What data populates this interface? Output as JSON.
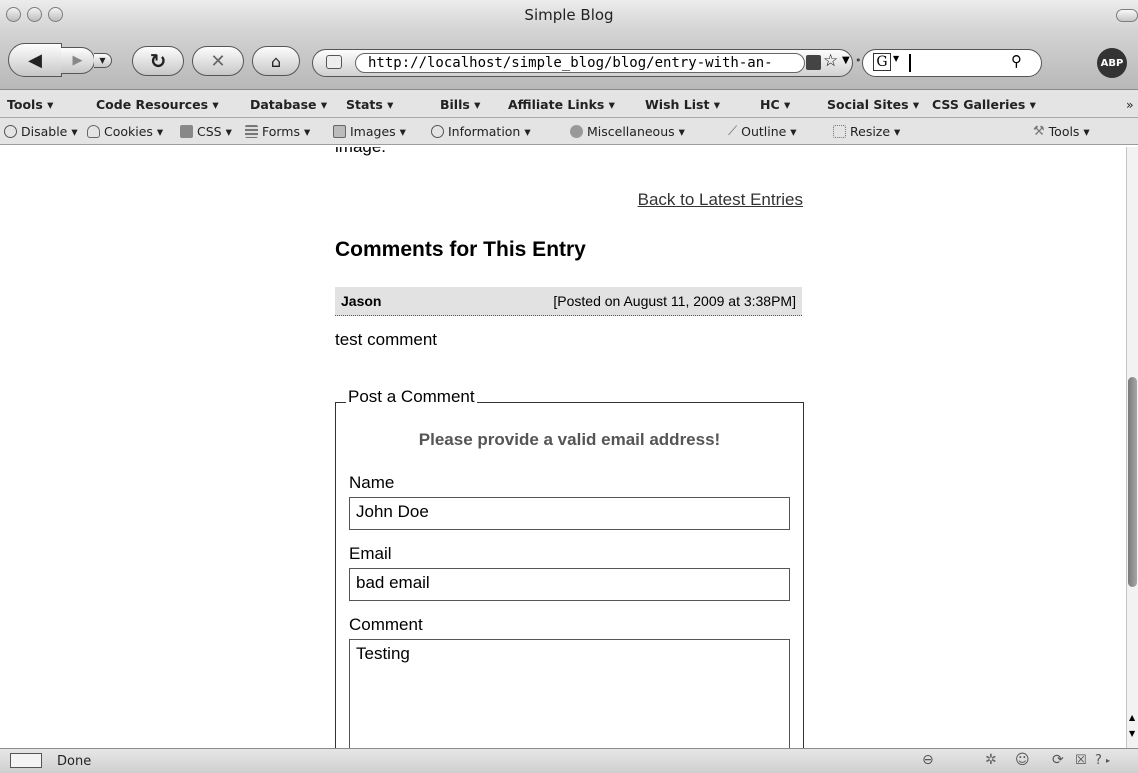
{
  "window": {
    "title": "Simple Blog"
  },
  "nav": {
    "url": "http://localhost/simple_blog/blog/entry-with-an-",
    "search_engine_letter": "G",
    "adblock_label": "ABP"
  },
  "bookmarks": [
    "Tools ▾",
    "Code Resources ▾",
    "Database ▾",
    "Stats ▾",
    "Bills ▾",
    "Affiliate Links ▾",
    "Wish List ▾",
    "HC ▾",
    "Social Sites ▾",
    "CSS Galleries ▾"
  ],
  "bookmarks_overflow": "»",
  "devtoolbar": [
    "Disable ▾",
    "Cookies ▾",
    "CSS ▾",
    "Forms ▾",
    "Images ▾",
    "Information ▾",
    "Miscellaneous ▾",
    "Outline ▾",
    "Resize ▾",
    "Tools ▾"
  ],
  "page": {
    "partial_text": "image.",
    "back_link": "Back to Latest Entries",
    "comments_heading": "Comments for This Entry",
    "comment": {
      "author": "Jason",
      "date": "[Posted on August 11, 2009 at 3:38PM]",
      "body": "test comment"
    },
    "form": {
      "legend": "Post a Comment",
      "error": "Please provide a valid email address!",
      "name_label": "Name",
      "name_value": "John Doe",
      "email_label": "Email",
      "email_value": "bad email",
      "comment_label": "Comment",
      "comment_value": "Testing"
    }
  },
  "status": {
    "text": "Done"
  }
}
